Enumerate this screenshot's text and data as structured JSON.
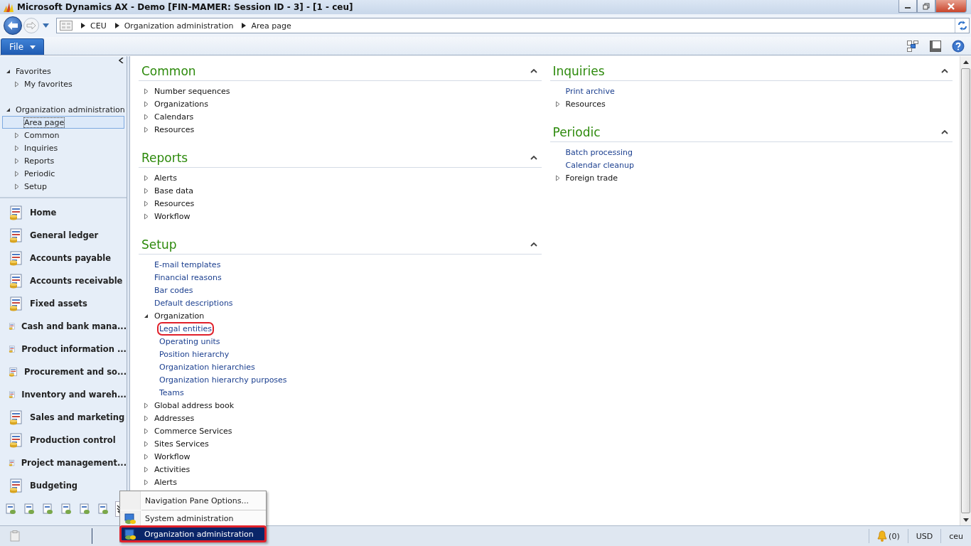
{
  "window": {
    "title": "Microsoft Dynamics AX - Demo [FIN-MAMER: Session ID - 3] -  [1 - ceu]"
  },
  "address_bar": {
    "breadcrumb": [
      "CEU",
      "Organization administration",
      "Area page"
    ]
  },
  "menu": {
    "file": "File"
  },
  "nav_tree": [
    {
      "label": "Favorites",
      "expanded": true,
      "children": [
        {
          "label": "My favorites",
          "expanded": false
        }
      ]
    },
    {
      "label": "Organization administration",
      "expanded": true,
      "children": [
        {
          "label": "Area page",
          "selected": true
        },
        {
          "label": "Common",
          "expanded": false,
          "selected": false
        },
        {
          "label": "Inquiries",
          "expanded": false,
          "selected": false
        },
        {
          "label": "Reports",
          "expanded": false,
          "selected": false
        },
        {
          "label": "Periodic",
          "expanded": false,
          "selected": false
        },
        {
          "label": "Setup",
          "expanded": false,
          "selected": false
        }
      ]
    }
  ],
  "modules": [
    "Home",
    "General ledger",
    "Accounts payable",
    "Accounts receivable",
    "Fixed assets",
    "Cash and bank mana...",
    "Product information ...",
    "Procurement and so...",
    "Inventory and wareh...",
    "Sales and marketing",
    "Production control",
    "Project management...",
    "Budgeting"
  ],
  "columns": [
    {
      "sections": [
        {
          "title": "Common",
          "expanded": true,
          "items": [
            {
              "kind": "group",
              "label": "Number sequences",
              "expanded": false
            },
            {
              "kind": "group",
              "label": "Organizations",
              "expanded": false
            },
            {
              "kind": "group",
              "label": "Calendars",
              "expanded": false
            },
            {
              "kind": "group",
              "label": "Resources",
              "expanded": false
            }
          ]
        },
        {
          "title": "Reports",
          "expanded": true,
          "items": [
            {
              "kind": "group",
              "label": "Alerts",
              "expanded": false
            },
            {
              "kind": "group",
              "label": "Base data",
              "expanded": false
            },
            {
              "kind": "group",
              "label": "Resources",
              "expanded": false
            },
            {
              "kind": "group",
              "label": "Workflow",
              "expanded": false
            }
          ]
        },
        {
          "title": "Setup",
          "expanded": true,
          "items": [
            {
              "kind": "link",
              "label": "E-mail templates",
              "highlighted": false
            },
            {
              "kind": "link",
              "label": "Financial reasons",
              "highlighted": false
            },
            {
              "kind": "link",
              "label": "Bar codes",
              "highlighted": false
            },
            {
              "kind": "link",
              "label": "Default descriptions",
              "highlighted": false
            },
            {
              "kind": "group",
              "label": "Organization",
              "expanded": true,
              "children": [
                {
                  "kind": "link",
                  "label": "Legal entities",
                  "highlighted": true
                },
                {
                  "kind": "link",
                  "label": "Operating units",
                  "highlighted": false
                },
                {
                  "kind": "link",
                  "label": "Position hierarchy",
                  "highlighted": false
                },
                {
                  "kind": "link",
                  "label": "Organization hierarchies",
                  "highlighted": false
                },
                {
                  "kind": "link",
                  "label": "Organization hierarchy purposes",
                  "highlighted": false
                },
                {
                  "kind": "link",
                  "label": "Teams",
                  "highlighted": false
                }
              ]
            },
            {
              "kind": "group",
              "label": "Global address book",
              "expanded": false
            },
            {
              "kind": "group",
              "label": "Addresses",
              "expanded": false
            },
            {
              "kind": "group",
              "label": "Commerce Services",
              "expanded": false
            },
            {
              "kind": "group",
              "label": "Sites Services",
              "expanded": false
            },
            {
              "kind": "group",
              "label": "Workflow",
              "expanded": false
            },
            {
              "kind": "group",
              "label": "Activities",
              "expanded": false
            },
            {
              "kind": "group",
              "label": "Alerts",
              "expanded": false
            }
          ]
        }
      ]
    },
    {
      "sections": [
        {
          "title": "Inquiries",
          "expanded": true,
          "items": [
            {
              "kind": "link",
              "label": "Print archive",
              "highlighted": false
            },
            {
              "kind": "group",
              "label": "Resources",
              "expanded": false
            }
          ]
        },
        {
          "title": "Periodic",
          "expanded": true,
          "items": [
            {
              "kind": "link",
              "label": "Batch processing",
              "highlighted": false
            },
            {
              "kind": "link",
              "label": "Calendar cleanup",
              "highlighted": false
            },
            {
              "kind": "group",
              "label": "Foreign trade",
              "expanded": false
            }
          ]
        }
      ]
    }
  ],
  "popup_menu": [
    {
      "kind": "option",
      "label": "Navigation Pane Options..."
    },
    {
      "kind": "module",
      "label": "System administration",
      "selected": false,
      "highlighted": false
    },
    {
      "kind": "module",
      "label": "Organization administration",
      "selected": true,
      "highlighted": true
    }
  ],
  "status_bar": {
    "notifications": "(0)",
    "currency": "USD",
    "company": "ceu"
  }
}
